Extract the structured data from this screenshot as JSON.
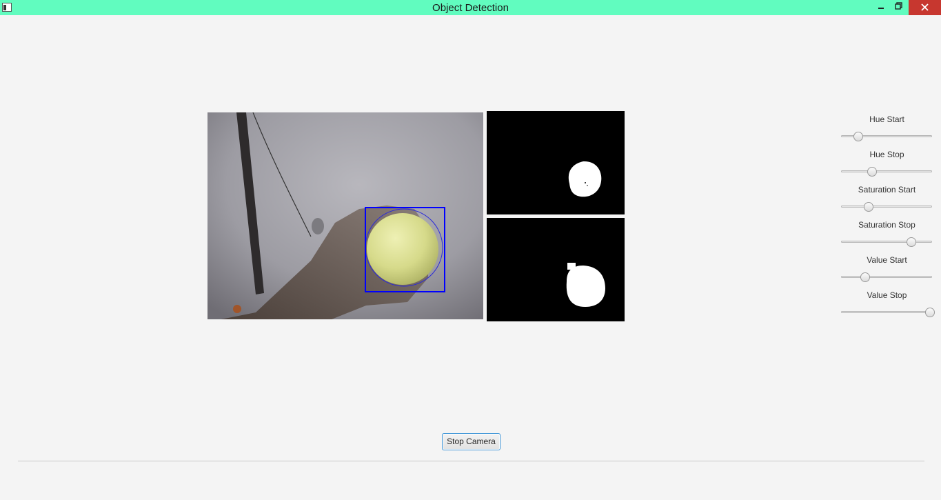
{
  "window": {
    "title": "Object Detection",
    "app_icon": "window-icon",
    "controls": [
      "minimize-icon",
      "maximize-icon",
      "close-icon"
    ],
    "titlebar_color": "#61fcbf",
    "close_color": "#c7372f"
  },
  "views": {
    "camera": {
      "icon": "camera-frame",
      "detection_box_color": "#0000ff"
    },
    "mask": {
      "icon": "binary-mask"
    },
    "morph": {
      "icon": "morphology-output"
    }
  },
  "sliders": [
    {
      "label": "Hue Start",
      "value": 0.13
    },
    {
      "label": "Hue Stop",
      "value": 0.29
    },
    {
      "label": "Saturation Start",
      "value": 0.25
    },
    {
      "label": "Saturation Stop",
      "value": 0.77
    },
    {
      "label": "Value Start",
      "value": 0.21
    },
    {
      "label": "Value Stop",
      "value": 1.0
    }
  ],
  "buttons": {
    "stop_camera": "Stop Camera",
    "accent": "#3a93d6"
  }
}
